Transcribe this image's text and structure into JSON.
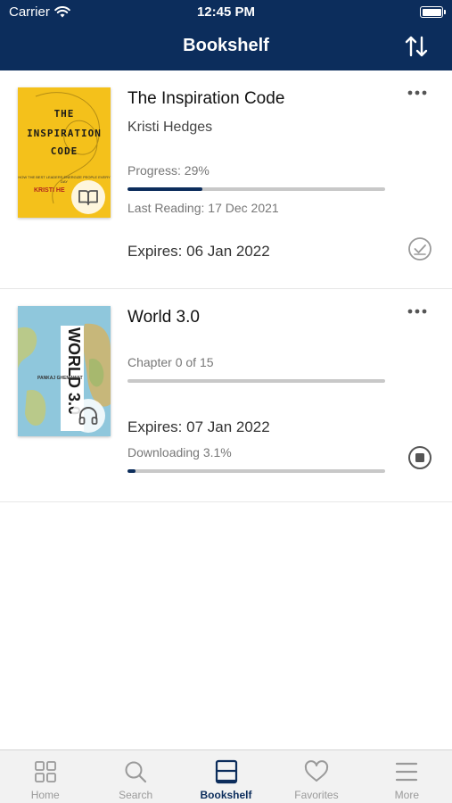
{
  "status_bar": {
    "carrier": "Carrier",
    "time": "12:45 PM"
  },
  "header": {
    "title": "Bookshelf"
  },
  "books": [
    {
      "title": "The Inspiration Code",
      "author": "Kristi Hedges",
      "progress_label": "Progress: 29%",
      "progress": 0.29,
      "last_reading": "Last Reading: 17 Dec 2021",
      "expires": "Expires: 06 Jan 2022",
      "cover": {
        "line1": "THE",
        "line2": "INSPIRATION",
        "line3": "CODE",
        "small": "HOW THE BEST LEADERS ENERGIZE PEOPLE EVERY DAY",
        "author": "KRISTI HE",
        "badge_icon": "book-icon"
      },
      "status_icon": "check-circle-icon"
    },
    {
      "title": "World 3.0",
      "chapter_label": "Chapter 0 of 15",
      "chapter_progress": 0,
      "expires": "Expires: 07 Jan 2022",
      "downloading_label": "Downloading 3.1%",
      "download_progress": 0.031,
      "cover": {
        "title": "WORLD 3.0",
        "author": "PANKAJ GHEMAWAT",
        "badge_icon": "headphones-icon"
      },
      "status_icon": "stop-circle-icon"
    }
  ],
  "tabbar": {
    "items": [
      {
        "label": "Home",
        "icon": "grid-icon",
        "active": false
      },
      {
        "label": "Search",
        "icon": "search-icon",
        "active": false
      },
      {
        "label": "Bookshelf",
        "icon": "bookshelf-icon",
        "active": true
      },
      {
        "label": "Favorites",
        "icon": "heart-icon",
        "active": false
      },
      {
        "label": "More",
        "icon": "menu-icon",
        "active": false
      }
    ]
  },
  "colors": {
    "header_bg": "#0c2d5c",
    "accent": "#0c2d5c",
    "inactive": "#9a9a9a"
  }
}
